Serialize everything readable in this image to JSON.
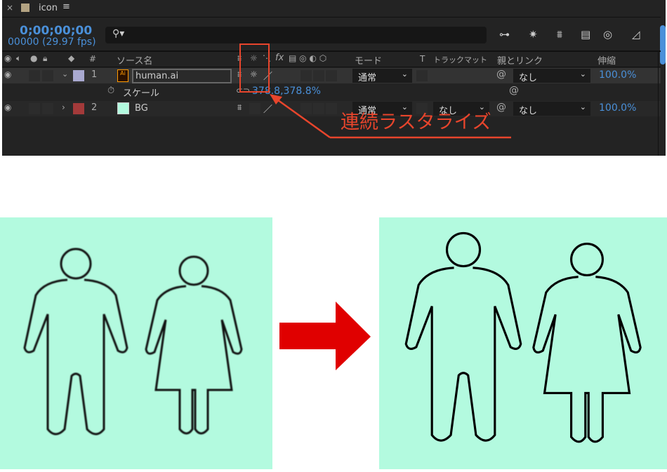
{
  "panel": {
    "close": "×",
    "title": "icon",
    "menu": "≡",
    "timecode": "0;00;00;00",
    "frames": "00000 (29.97 fps)",
    "search_icon": "search-icon",
    "headers": {
      "hash": "#",
      "source": "ソース名",
      "fx": "fx",
      "mode": "モード",
      "t": "T",
      "trackmatte": "トラックマット",
      "parent": "親とリンク",
      "stretch": "伸縮"
    },
    "layers": [
      {
        "num": "1",
        "name": "human.ai",
        "label_color": "#a9a9d0",
        "mode": "通常",
        "parent": "なし",
        "stretch": "100.0%"
      },
      {
        "num": "2",
        "name": "BG",
        "label_color": "#a33a3a",
        "mode": "通常",
        "trackmatte": "なし",
        "parent": "なし",
        "stretch": "100.0%"
      }
    ],
    "property": {
      "name": "スケール",
      "value": "378.8,378.8%"
    }
  },
  "annotation": {
    "text": "連続ラスタライズ",
    "color": "#e8452c"
  },
  "colors": {
    "mint": "#b3fadf",
    "arrow": "#e00000",
    "accent": "#4a90d9"
  }
}
